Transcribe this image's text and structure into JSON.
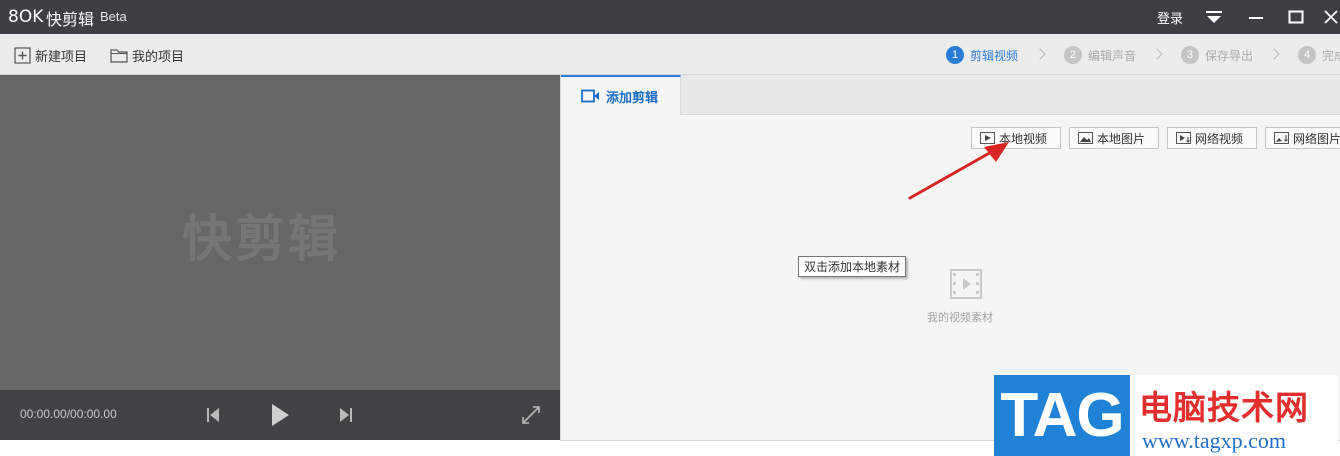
{
  "app": {
    "logo_text": "8OK",
    "name": "快剪辑",
    "edition": "Beta"
  },
  "titlebar": {
    "login_label": "登录"
  },
  "toolbar": {
    "new_project_label": "新建项目",
    "my_projects_label": "我的项目",
    "steps": [
      {
        "num": "1",
        "label": "剪辑视频",
        "active": true
      },
      {
        "num": "2",
        "label": "编辑声音",
        "active": false
      },
      {
        "num": "3",
        "label": "保存导出",
        "active": false
      },
      {
        "num": "4",
        "label": "完成",
        "active": false
      }
    ]
  },
  "preview": {
    "watermark": "快剪辑",
    "time": "00:00.00/00:00.00"
  },
  "panel": {
    "tab_label": "添加剪辑",
    "source_buttons": [
      {
        "label": "本地视频",
        "icon": "video-file-icon"
      },
      {
        "label": "本地图片",
        "icon": "image-icon"
      },
      {
        "label": "网络视频",
        "icon": "network-video-icon"
      },
      {
        "label": "网络图片",
        "icon": "network-image-icon"
      }
    ],
    "tooltip": "双击添加本地素材",
    "empty_label": "我的视频素材"
  },
  "overlay": {
    "tag": "TAG",
    "site_name": "电脑技术网",
    "site_url": "www.tagxp.com"
  },
  "colors": {
    "accent": "#2a7dd7",
    "titlebar": "#3c3f44",
    "preview_bg": "#666666",
    "arrow": "#d92424"
  }
}
